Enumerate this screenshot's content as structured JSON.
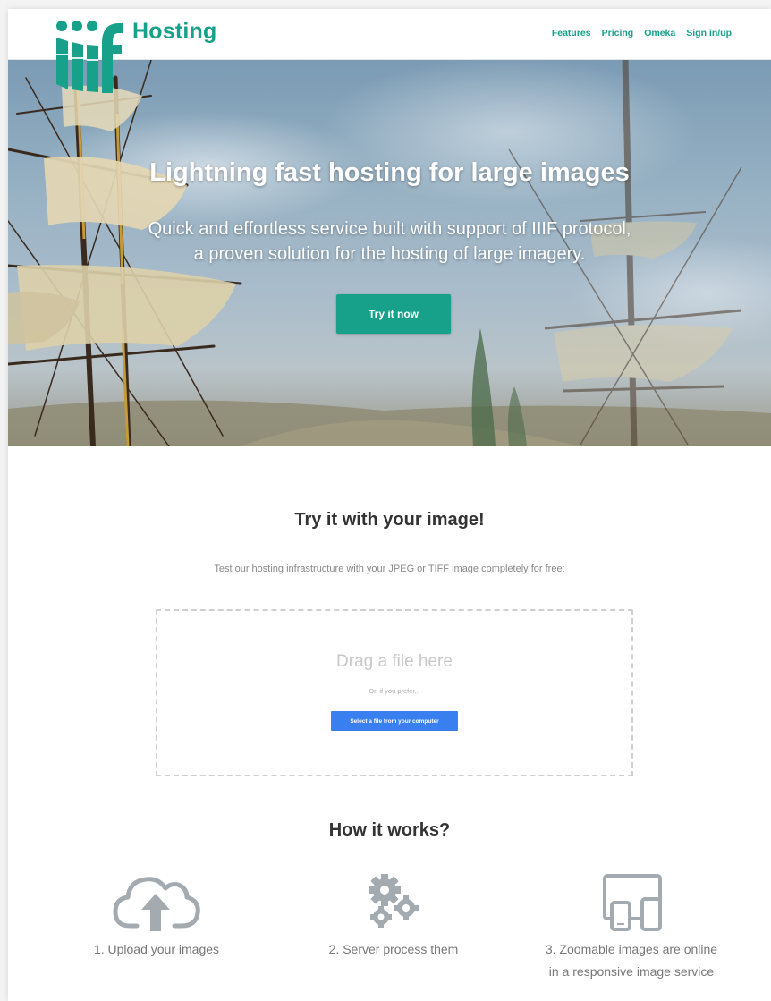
{
  "header": {
    "brand": "Hosting",
    "logo_text": "iiif",
    "nav": [
      {
        "label": "Features"
      },
      {
        "label": "Pricing"
      },
      {
        "label": "Omeka"
      },
      {
        "label": "Sign in/up"
      }
    ]
  },
  "hero": {
    "title": "Lightning fast hosting for large images",
    "subtitle_line1": "Quick and effortless service built with support of IIIF protocol,",
    "subtitle_line2": "a proven solution for the hosting of large imagery.",
    "cta_label": "Try it now"
  },
  "try_section": {
    "title": "Try it with your image!",
    "description": "Test our hosting infrastructure with your JPEG or TIFF image completely for free:",
    "dropzone": {
      "title": "Drag a file here",
      "or_text": "Or, if you prefer...",
      "button_label": "Select a file from your computer"
    }
  },
  "how_section": {
    "title": "How it works?",
    "steps": [
      {
        "icon": "cloud-upload-icon",
        "label": "1. Upload your images"
      },
      {
        "icon": "gears-icon",
        "label": "2. Server process them"
      },
      {
        "icon": "devices-icon",
        "label_line1": "3. Zoomable images are online",
        "label_line2": "in a responsive image service"
      }
    ]
  },
  "colors": {
    "brand": "#17a08a",
    "select_button": "#3a7ff0",
    "icon_gray": "#a3aab0"
  }
}
